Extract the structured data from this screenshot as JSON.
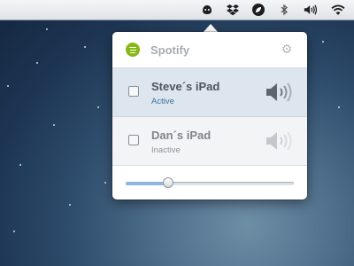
{
  "menubar": {
    "icons": [
      "spotify-status-icon",
      "dropbox-icon",
      "leaf-icon",
      "bluetooth-icon",
      "volume-icon",
      "wifi-icon"
    ]
  },
  "popover": {
    "app_title": "Spotify",
    "devices": [
      {
        "name": "Steve´s iPad",
        "status": "Active"
      },
      {
        "name": "Dan´s iPad",
        "status": "Inactive"
      }
    ],
    "volume": 0.25
  },
  "colors": {
    "spotify_green": "#86b817",
    "active_row": "#dde5ee",
    "active_status": "#3d6f9e",
    "slider_fill": "#8fb6dc"
  }
}
